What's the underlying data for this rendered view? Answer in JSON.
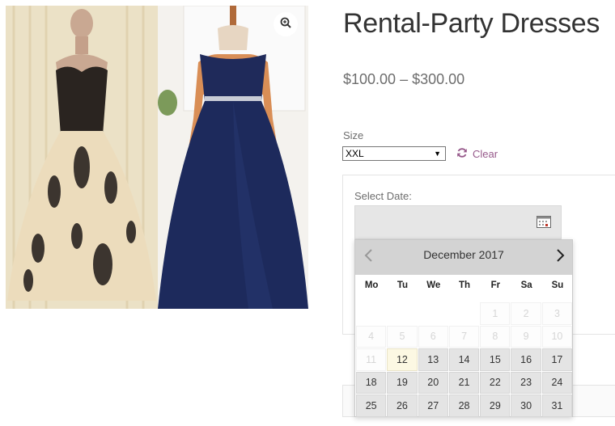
{
  "product": {
    "title": "Rental-Party Dresses",
    "price": "$100.00 – $300.00",
    "zoom_icon": "zoom-in-icon"
  },
  "variation": {
    "size_label": "Size",
    "size_value": "XXL",
    "clear_label": "Clear",
    "clear_icon": "refresh-icon"
  },
  "booking": {
    "date_label": "Select Date:",
    "calendar_icon": "calendar-icon"
  },
  "datepicker": {
    "month_title": "December 2017",
    "weekdays": [
      "Mo",
      "Tu",
      "We",
      "Th",
      "Fr",
      "Sa",
      "Su"
    ],
    "weeks": [
      [
        {
          "d": "",
          "s": "empty"
        },
        {
          "d": "",
          "s": "empty"
        },
        {
          "d": "",
          "s": "empty"
        },
        {
          "d": "",
          "s": "empty"
        },
        {
          "d": "1",
          "s": "disabled"
        },
        {
          "d": "2",
          "s": "disabled"
        },
        {
          "d": "3",
          "s": "disabled"
        }
      ],
      [
        {
          "d": "4",
          "s": "disabled"
        },
        {
          "d": "5",
          "s": "disabled"
        },
        {
          "d": "6",
          "s": "disabled"
        },
        {
          "d": "7",
          "s": "disabled"
        },
        {
          "d": "8",
          "s": "disabled"
        },
        {
          "d": "9",
          "s": "disabled"
        },
        {
          "d": "10",
          "s": "disabled"
        }
      ],
      [
        {
          "d": "11",
          "s": "disabled"
        },
        {
          "d": "12",
          "s": "today"
        },
        {
          "d": "13",
          "s": "active"
        },
        {
          "d": "14",
          "s": "active"
        },
        {
          "d": "15",
          "s": "active"
        },
        {
          "d": "16",
          "s": "active"
        },
        {
          "d": "17",
          "s": "active"
        }
      ],
      [
        {
          "d": "18",
          "s": "active"
        },
        {
          "d": "19",
          "s": "active"
        },
        {
          "d": "20",
          "s": "active"
        },
        {
          "d": "21",
          "s": "active"
        },
        {
          "d": "22",
          "s": "active"
        },
        {
          "d": "23",
          "s": "active"
        },
        {
          "d": "24",
          "s": "active"
        }
      ],
      [
        {
          "d": "25",
          "s": "active"
        },
        {
          "d": "26",
          "s": "active"
        },
        {
          "d": "27",
          "s": "active"
        },
        {
          "d": "28",
          "s": "active"
        },
        {
          "d": "29",
          "s": "active"
        },
        {
          "d": "30",
          "s": "active"
        },
        {
          "d": "31",
          "s": "active"
        }
      ]
    ]
  },
  "colors": {
    "accent": "#96588a",
    "title": "#333333",
    "text": "#6d6d6d",
    "calendar_header": "#d3d3d3",
    "today_highlight": "#fcf8e3"
  }
}
